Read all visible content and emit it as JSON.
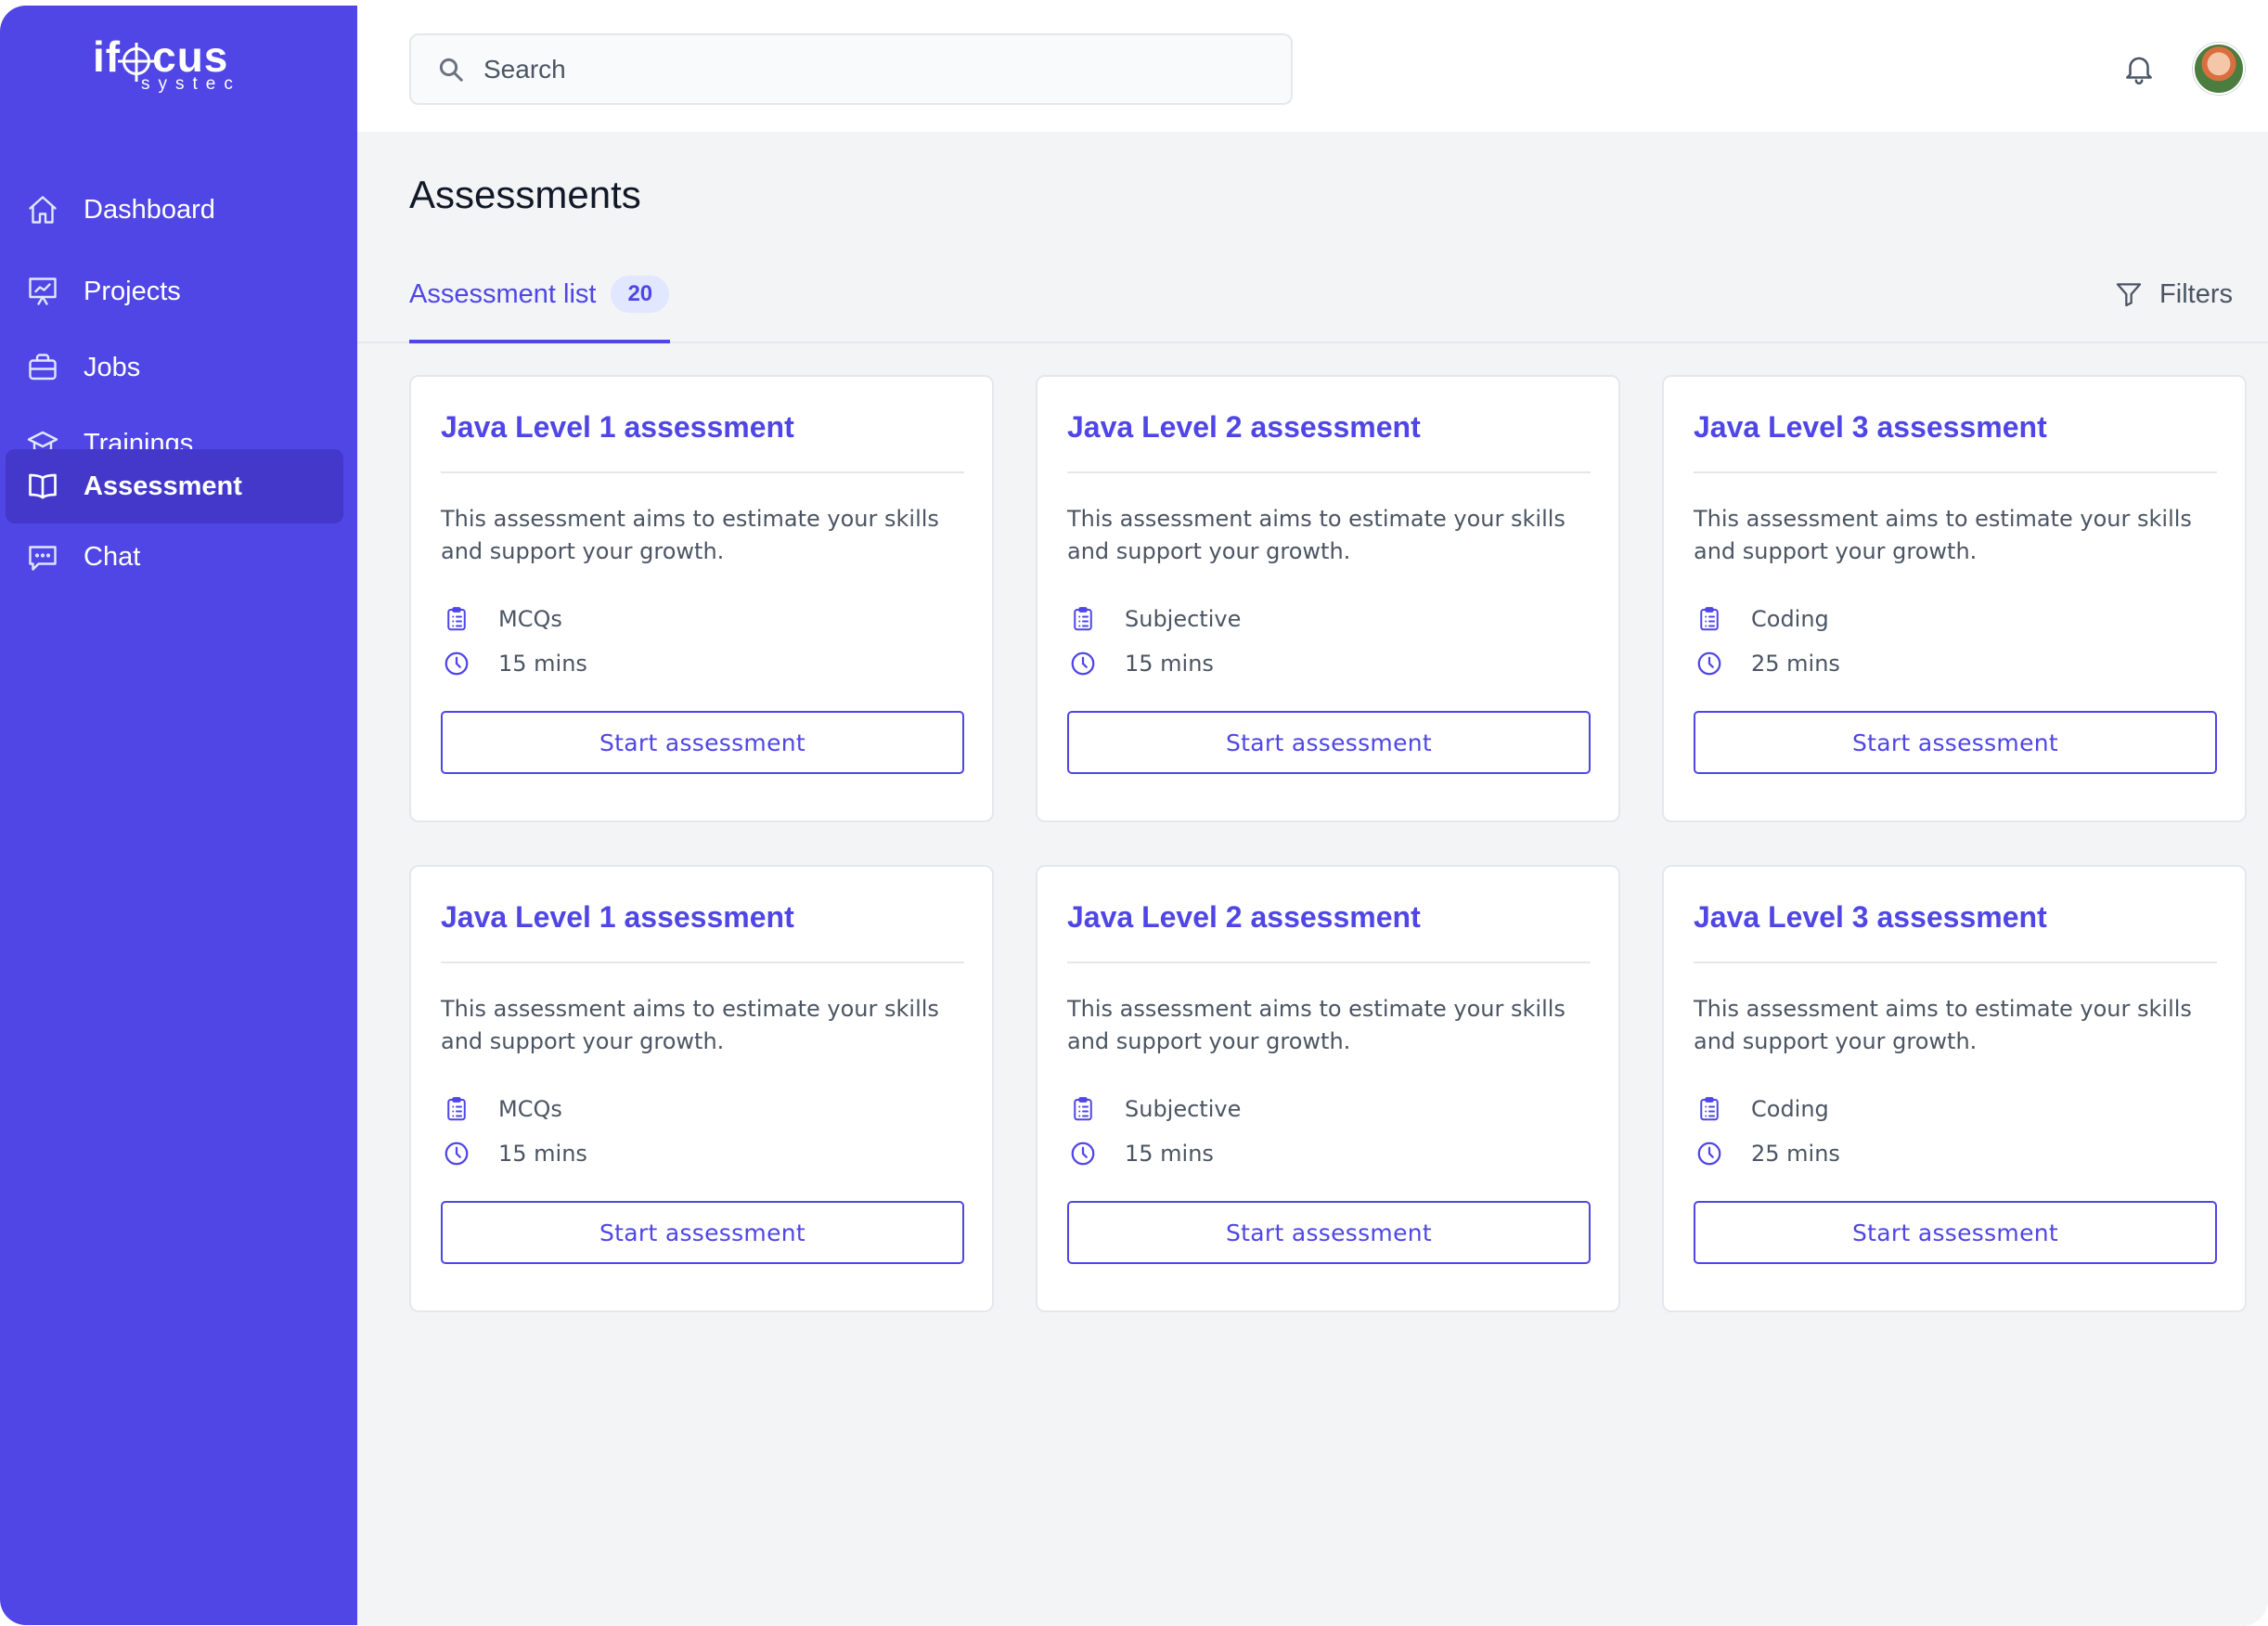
{
  "brand": {
    "logo_main_prefix": "if",
    "logo_main_suffix": "cus",
    "logo_sub": "systec"
  },
  "colors": {
    "accent": "#4f46e5",
    "sidebar": "#4f46e5",
    "active_nav": "#4338ca",
    "badge_bg": "#e0e7ff",
    "page_bg": "#f3f4f6"
  },
  "sidebar": {
    "items": [
      {
        "label": "Dashboard",
        "icon": "home-icon"
      },
      {
        "label": "Projects",
        "icon": "presentation-chart-icon"
      },
      {
        "label": "Jobs",
        "icon": "briefcase-icon"
      },
      {
        "label": "Trainings",
        "icon": "graduation-cap-icon"
      },
      {
        "label": "Assessment",
        "icon": "book-open-icon",
        "active": true
      },
      {
        "label": "Chat",
        "icon": "chat-bubble-icon"
      }
    ]
  },
  "header": {
    "search": {
      "placeholder": "Search",
      "value": ""
    },
    "notification_icon": "bell-icon",
    "avatar_icon": "user-avatar"
  },
  "main": {
    "title": "Assessments",
    "tab": {
      "label": "Assessment list",
      "count": "20"
    },
    "filters_label": "Filters"
  },
  "cards": [
    {
      "title": "Java Level 1 assessment",
      "description": "This assessment aims to estimate your skills and support your growth.",
      "type": "MCQs",
      "duration": "15 mins",
      "button": "Start assessment"
    },
    {
      "title": "Java Level 2 assessment",
      "description": "This assessment aims to estimate your skills and support your growth.",
      "type": "Subjective",
      "duration": "15 mins",
      "button": "Start assessment"
    },
    {
      "title": "Java Level 3 assessment",
      "description": "This assessment aims to estimate your skills and support your growth.",
      "type": "Coding",
      "duration": "25 mins",
      "button": "Start assessment"
    },
    {
      "title": "Java Level 1 assessment",
      "description": "This assessment aims to estimate your skills and support your growth.",
      "type": "MCQs",
      "duration": "15 mins",
      "button": "Start assessment"
    },
    {
      "title": "Java Level 2 assessment",
      "description": "This assessment aims to estimate your skills and support your growth.",
      "type": "Subjective",
      "duration": "15 mins",
      "button": "Start assessment"
    },
    {
      "title": "Java Level 3 assessment",
      "description": "This assessment aims to estimate your skills and support your growth.",
      "type": "Coding",
      "duration": "25 mins",
      "button": "Start assessment"
    }
  ]
}
